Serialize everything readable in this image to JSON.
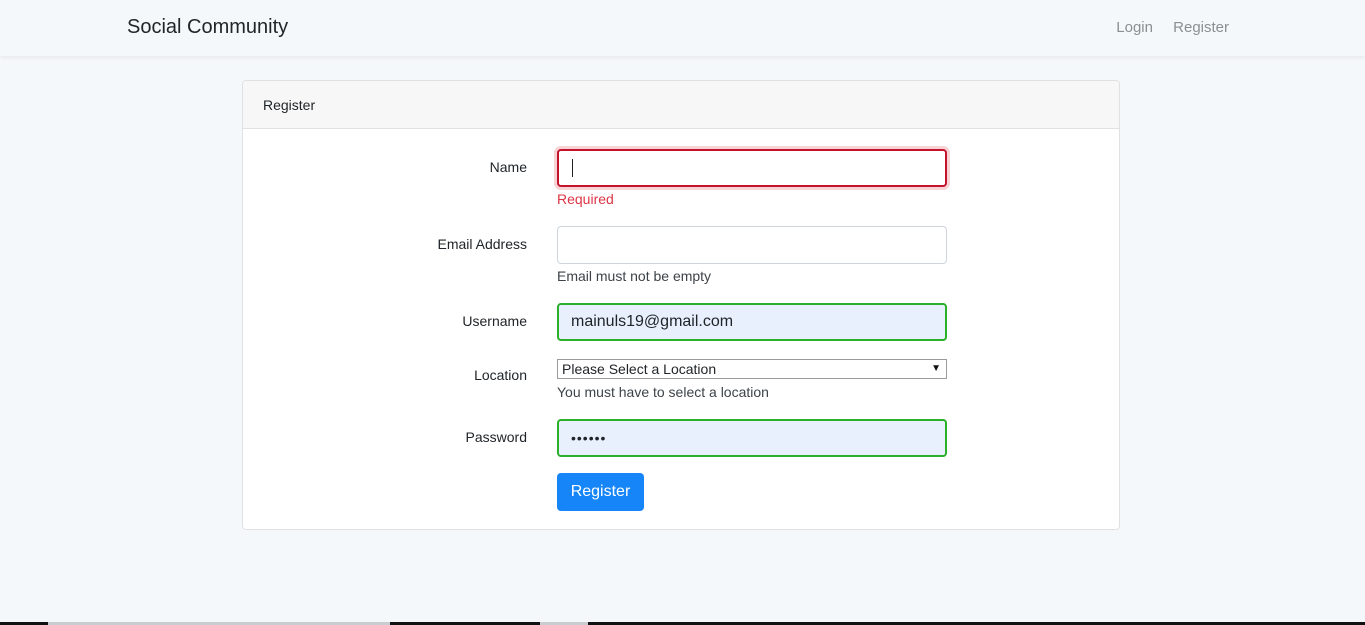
{
  "navbar": {
    "brand": "Social Community",
    "links": [
      "Login",
      "Register"
    ]
  },
  "card": {
    "header": "Register"
  },
  "form": {
    "name": {
      "label": "Name",
      "value": "",
      "feedback": "Required"
    },
    "email": {
      "label": "Email Address",
      "value": "",
      "feedback": "Email must not be empty"
    },
    "username": {
      "label": "Username",
      "value": "mainuls19@gmail.com"
    },
    "location": {
      "label": "Location",
      "selected": "Please Select a Location",
      "feedback": "You must have to select a location"
    },
    "password": {
      "label": "Password",
      "value": "••••••"
    },
    "submit_label": "Register"
  },
  "colors": {
    "primary": "#1685f8",
    "invalid": "#c3122b",
    "valid": "#2bb02b",
    "error_text": "#dc3545"
  }
}
